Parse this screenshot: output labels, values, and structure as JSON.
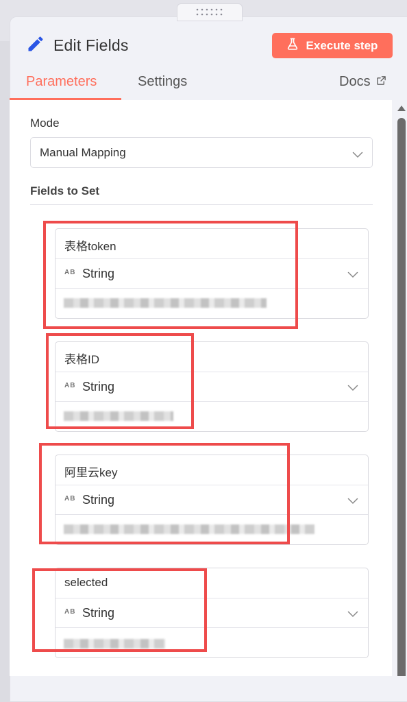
{
  "header": {
    "title": "Edit Fields",
    "execute_label": "Execute step"
  },
  "tabs": [
    {
      "label": "Parameters",
      "active": true
    },
    {
      "label": "Settings",
      "active": false
    },
    {
      "label": "Docs",
      "active": false
    }
  ],
  "mode": {
    "label": "Mode",
    "value": "Manual Mapping"
  },
  "fields_section": {
    "label": "Fields to Set"
  },
  "fields": [
    {
      "name": "表格token",
      "type": "String"
    },
    {
      "name": "表格ID",
      "type": "String"
    },
    {
      "name": "阿里云key",
      "type": "String"
    },
    {
      "name": "selected",
      "type": "String"
    }
  ],
  "type_icon_text": "AB",
  "colors": {
    "accent": "#ff6f5c",
    "highlight": "#ee4b4b",
    "edit_icon": "#2a55e5"
  },
  "icons": [
    "edit-pencil-icon",
    "flask-icon",
    "external-link-icon",
    "chevron-down-icon",
    "drag-handle-icon"
  ]
}
